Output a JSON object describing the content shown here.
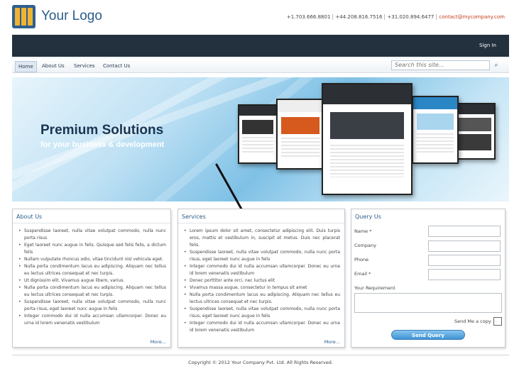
{
  "header": {
    "logo_text": "Your Logo",
    "phones": [
      "+1.703.666.8801",
      "+44.208.816.7516",
      "+31.020.894.6477"
    ],
    "email": "contact@mycompany.com",
    "signin_label": "Sign In"
  },
  "nav": {
    "items": [
      "Home",
      "About Us",
      "Services",
      "Contact Us"
    ],
    "active": "Home",
    "search_placeholder": "Search this site..."
  },
  "banner": {
    "title": "Premium Solutions",
    "subtitle": "for your business & development"
  },
  "about": {
    "title": "About Us",
    "items": [
      "Suspendisse laoreet, nulla vitae volutpat commodo, nulla nunc porta risus",
      "Eget laoreet nunc augue in felis. Quisque sed felis felis, a dictum felis",
      "Nullam vulputate rhoncus odio, vitae tincidunt nisl vehicula eget.",
      "Nulla porta condimentum lacus eu adipiscing. Aliquam nec tellus eu lectus ultrices consequat et nec turpis.",
      "Ut dignissim elit. Vivamus augue libero, varius.",
      "Nulla porta condimentum lacus eu adipiscing. Aliquam nec tellus eu lectus ultrices consequat et nec turpis.",
      "Suspendisse laoreet, nulla vitae volutpat commodo, nulla nunc porta risus, eget laoreet nunc augue in felis",
      "Integer commodo dui id nulla accumsan ullamcorper. Donec eu urna id lorem venenatis vestibulum"
    ],
    "more_label": "More..."
  },
  "services": {
    "title": "Services",
    "items": [
      "Lorem ipsum dolor sit amet, consectetur adipiscing elit. Duis turpis eros, mattis et vestibulum in, suscipit et metus. Duis nec placerat felis.",
      "Suspendisse laoreet, nulla vitae volutpat commodo, nulla nunc porta risus, eget laoreet nunc augue in felis",
      "Integer commodo dui id nulla accumsan ullamcorper. Donec eu urna id lorem venenatis vestibulum",
      "Donec porttitor ante orci, nec luctus elit",
      "Vivamus massa augue, consectetur in tempus sit amet",
      "Nulla porta condimentum lacus eu adipiscing. Aliquam nec tellus eu lectus ultrices consequat et nec turpis.",
      "Suspendisse laoreet, nulla vitae volutpat commodo, nulla nunc porta risus, eget laoreet nunc augue in felis",
      "Integer commodo dui id nulla accumsan ullamcorper. Donec eu urna id lorem venenatis vestibulum"
    ],
    "more_label": "More..."
  },
  "query": {
    "title": "Query Us",
    "fields": [
      "Name *",
      "Company",
      "Phone",
      "Email *"
    ],
    "requirement_label": "Your Requirement",
    "copy_label": "Send Me a copy",
    "submit_label": "Send Query"
  },
  "footer": {
    "copyright": "Copyright © 2012 Your Company Pvt. Ltd. All Rights Reserved."
  },
  "colors": {
    "brand": "#2a5c8a",
    "topbar": "#23303d",
    "accent": "#c53b1a",
    "button": "#3f93d4"
  }
}
